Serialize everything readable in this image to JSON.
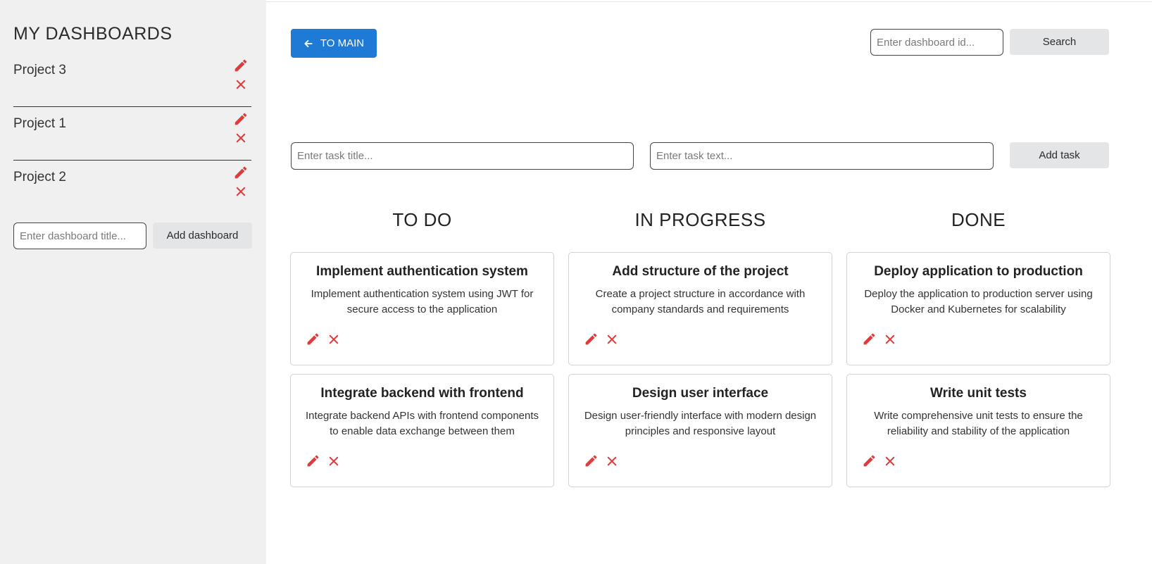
{
  "sidebar": {
    "title": "MY DASHBOARDS",
    "items": [
      {
        "label": "Project 3"
      },
      {
        "label": "Project 1"
      },
      {
        "label": "Project 2"
      }
    ],
    "new_dashboard_placeholder": "Enter dashboard title...",
    "add_dashboard_label": "Add dashboard"
  },
  "header": {
    "to_main_label": "TO MAIN",
    "search_placeholder": "Enter dashboard id...",
    "search_label": "Search"
  },
  "task_form": {
    "title_placeholder": "Enter task title...",
    "text_placeholder": "Enter task text...",
    "add_task_label": "Add task"
  },
  "columns": [
    {
      "title": "TO DO",
      "tasks": [
        {
          "title": "Implement authentication system",
          "text": "Implement authentication system using JWT for secure access to the application"
        },
        {
          "title": "Integrate backend with frontend",
          "text": "Integrate backend APIs with frontend components to enable data exchange between them"
        }
      ]
    },
    {
      "title": "IN PROGRESS",
      "tasks": [
        {
          "title": "Add structure of the project",
          "text": "Create a project structure in accordance with company standards and requirements"
        },
        {
          "title": "Design user interface",
          "text": "Design user-friendly interface with modern design principles and responsive layout"
        }
      ]
    },
    {
      "title": "DONE",
      "tasks": [
        {
          "title": "Deploy application to production",
          "text": "Deploy the application to production server using Docker and Kubernetes for scalability"
        },
        {
          "title": "Write unit tests",
          "text": "Write comprehensive unit tests to ensure the reliability and stability of the application"
        }
      ]
    }
  ],
  "colors": {
    "accent": "#1f7ad6",
    "icon_red": "#e03b3b",
    "sidebar_bg": "#f0f0f0",
    "button_grey": "#e3e5e7"
  },
  "icons": {
    "edit": "pencil-icon",
    "delete": "close-icon",
    "back": "arrow-left-icon"
  }
}
